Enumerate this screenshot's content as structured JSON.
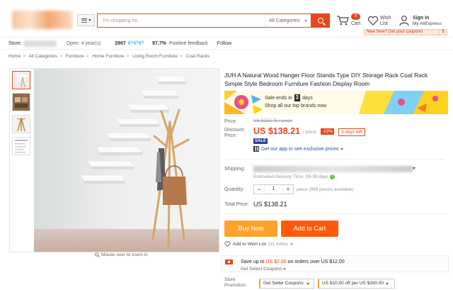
{
  "header": {
    "search_placeholder": "I'm shopping for...",
    "search_category": "All Categories",
    "cart_count": "0",
    "cart_label": "Cart",
    "wish_label": "Wish List",
    "signin_label": "Sign in",
    "account_label": "My AliExpress",
    "coupon_tip": "New here? Get your coupons!",
    "coupon_dollar": "$"
  },
  "store": {
    "label": "Store:",
    "open": "Open: 4 year(s)",
    "score": "2907",
    "diamonds": "💎💎💎",
    "positive_pct": "97.7%",
    "positive_label": "Positive feedback",
    "follow": "Follow"
  },
  "breadcrumb": [
    "Home",
    "All Categories",
    "Furniture",
    "Home Furniture",
    "Living Room Furniture",
    "Coat Racks"
  ],
  "gallery": {
    "zoom_hint": "Mouse over to zoom in"
  },
  "product": {
    "title": "JUH A Natural Wood Hanger Floor Stands Type DIY Storage Rack Coat Rack Simple Style Bedroom Furniture Fashion Display Room",
    "sale": {
      "ends_prefix": "Sale ends in",
      "days_num": "3",
      "days_word": "days",
      "shop_all": "Shop all our top brands now"
    },
    "price_label": "Price:",
    "old_price": "US $152.75 / piece",
    "discount_label": "Discount Price:",
    "price": "US $138.21",
    "per_piece": "/ piece",
    "discount_badge": "-10%",
    "days_left": "3 days left",
    "sale_tag": "SALE",
    "app_line": "Get our app to see exclusive prices",
    "shipping_label": "Shipping:",
    "delivery_prefix": "Estimated Delivery Time:",
    "delivery_days": "19-39 days",
    "quantity_label": "Quantity:",
    "quantity": "1",
    "qty_minus": "−",
    "qty_plus": "+",
    "qty_note": "piece (999 pieces available)",
    "total_label": "Total Price:",
    "total": "US $138.21",
    "buy_now": "Buy Now",
    "add_to_cart": "Add to Cart",
    "wishlist": "Add to Wish List",
    "wishlist_count": "(31 Adds)",
    "save_prefix": "Save up to",
    "save_amount": "US $2.00",
    "save_suffix": "on orders over US $12.00",
    "get_select": "Get Select Coupons",
    "store_promotion_label": "Store Promotion:",
    "seller_coupons": "Get Seller Coupons",
    "promo_off": "US $10.00 off per US $300.00"
  }
}
